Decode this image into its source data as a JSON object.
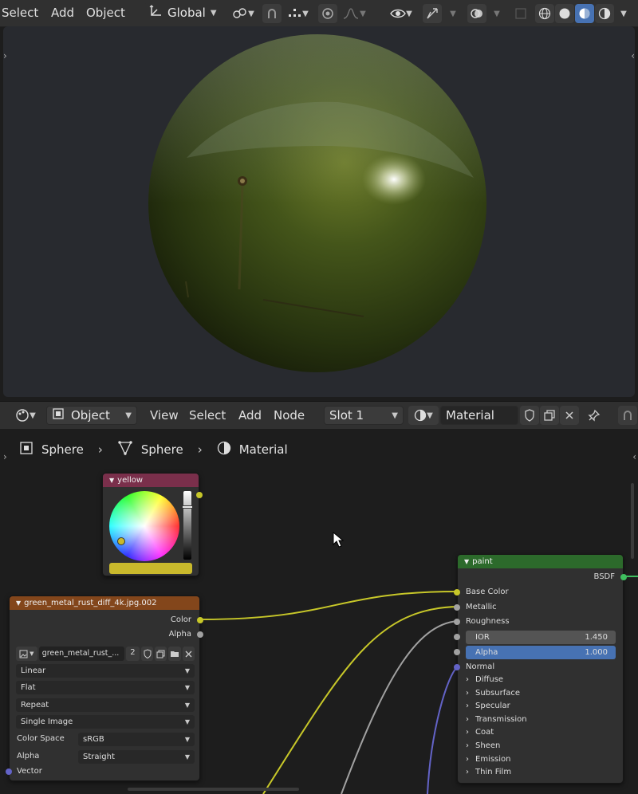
{
  "top_header": {
    "menus": [
      "Select",
      "Add",
      "Object"
    ],
    "orientation": "Global"
  },
  "node_header": {
    "mode": "Object",
    "menus": [
      "View",
      "Select",
      "Add",
      "Node"
    ],
    "slot": "Slot 1",
    "material": "Material"
  },
  "breadcrumb": [
    "Sphere",
    "Sphere",
    "Material"
  ],
  "yellow_node": {
    "title": "yellow",
    "swatch_color": "#c9b92c"
  },
  "image_node": {
    "title": "green_metal_rust_diff_4k.jpg.002",
    "outputs": [
      "Color",
      "Alpha"
    ],
    "image_name": "green_metal_rust_...",
    "users": "2",
    "interpolation": "Linear",
    "projection": "Flat",
    "extension": "Repeat",
    "source": "Single Image",
    "color_space_label": "Color Space",
    "color_space": "sRGB",
    "alpha_label": "Alpha",
    "alpha_mode": "Straight",
    "vector_label": "Vector"
  },
  "paint_node": {
    "title": "paint",
    "output": "BSDF",
    "inputs": [
      "Base Color",
      "Metallic",
      "Roughness"
    ],
    "ior_label": "IOR",
    "ior_value": "1.450",
    "alpha_label": "Alpha",
    "alpha_value": "1.000",
    "normal_label": "Normal",
    "panels": [
      "Diffuse",
      "Subsurface",
      "Specular",
      "Transmission",
      "Coat",
      "Sheen",
      "Emission",
      "Thin Film"
    ]
  },
  "colors": {
    "accent": "#4772b3",
    "texture_header": "#83461b",
    "shader_header": "#2c6a2b",
    "color_header": "#7a2f4b",
    "link_yellow": "#c7c729",
    "link_gray": "#a1a1a1",
    "link_vector": "#6363c7"
  }
}
